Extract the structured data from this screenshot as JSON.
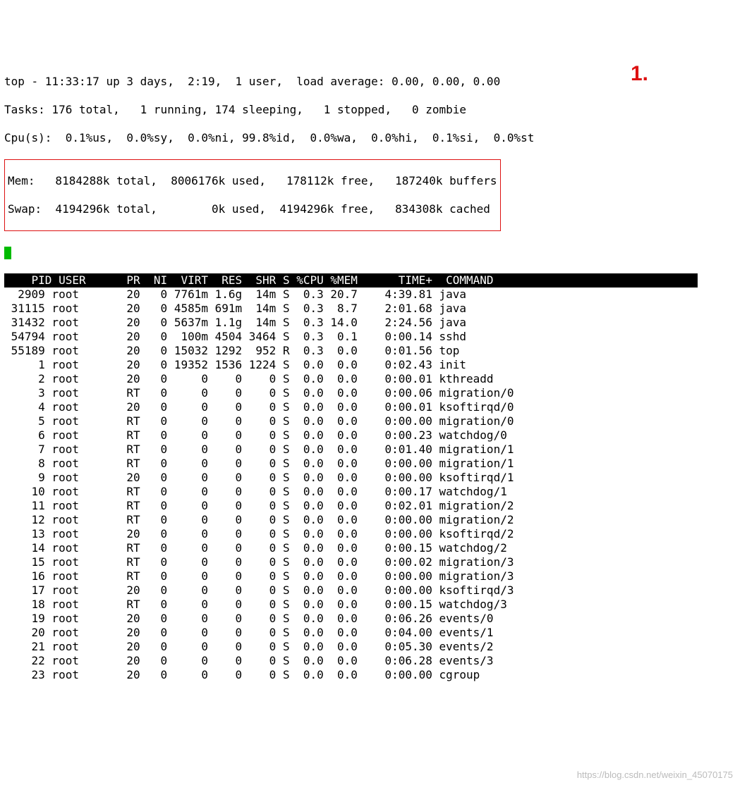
{
  "summary": {
    "line1": "top - 11:33:17 up 3 days,  2:19,  1 user,  load average: 0.00, 0.00, 0.00",
    "line2": "Tasks: 176 total,   1 running, 174 sleeping,   1 stopped,   0 zombie",
    "line3": "Cpu(s):  0.1%us,  0.0%sy,  0.0%ni, 99.8%id,  0.0%wa,  0.0%hi,  0.1%si,  0.0%st",
    "mem": "Mem:   8184288k total,  8006176k used,   178112k free,   187240k buffers",
    "swap": "Swap:  4194296k total,        0k used,  4194296k free,   834308k cached"
  },
  "annotation": "1.",
  "columns": [
    "PID",
    "USER",
    "PR",
    "NI",
    "VIRT",
    "RES",
    "SHR",
    "S",
    "%CPU",
    "%MEM",
    "TIME+",
    "COMMAND"
  ],
  "processes": [
    {
      "pid": "2909",
      "user": "root",
      "pr": "20",
      "ni": "0",
      "virt": "7761m",
      "res": "1.6g",
      "shr": "14m",
      "s": "S",
      "cpu": "0.3",
      "mem": "20.7",
      "time": "4:39.81",
      "cmd": "java"
    },
    {
      "pid": "31115",
      "user": "root",
      "pr": "20",
      "ni": "0",
      "virt": "4585m",
      "res": "691m",
      "shr": "14m",
      "s": "S",
      "cpu": "0.3",
      "mem": "8.7",
      "time": "2:01.68",
      "cmd": "java"
    },
    {
      "pid": "31432",
      "user": "root",
      "pr": "20",
      "ni": "0",
      "virt": "5637m",
      "res": "1.1g",
      "shr": "14m",
      "s": "S",
      "cpu": "0.3",
      "mem": "14.0",
      "time": "2:24.56",
      "cmd": "java"
    },
    {
      "pid": "54794",
      "user": "root",
      "pr": "20",
      "ni": "0",
      "virt": "100m",
      "res": "4504",
      "shr": "3464",
      "s": "S",
      "cpu": "0.3",
      "mem": "0.1",
      "time": "0:00.14",
      "cmd": "sshd"
    },
    {
      "pid": "55189",
      "user": "root",
      "pr": "20",
      "ni": "0",
      "virt": "15032",
      "res": "1292",
      "shr": "952",
      "s": "R",
      "cpu": "0.3",
      "mem": "0.0",
      "time": "0:01.56",
      "cmd": "top"
    },
    {
      "pid": "1",
      "user": "root",
      "pr": "20",
      "ni": "0",
      "virt": "19352",
      "res": "1536",
      "shr": "1224",
      "s": "S",
      "cpu": "0.0",
      "mem": "0.0",
      "time": "0:02.43",
      "cmd": "init"
    },
    {
      "pid": "2",
      "user": "root",
      "pr": "20",
      "ni": "0",
      "virt": "0",
      "res": "0",
      "shr": "0",
      "s": "S",
      "cpu": "0.0",
      "mem": "0.0",
      "time": "0:00.01",
      "cmd": "kthreadd"
    },
    {
      "pid": "3",
      "user": "root",
      "pr": "RT",
      "ni": "0",
      "virt": "0",
      "res": "0",
      "shr": "0",
      "s": "S",
      "cpu": "0.0",
      "mem": "0.0",
      "time": "0:00.06",
      "cmd": "migration/0"
    },
    {
      "pid": "4",
      "user": "root",
      "pr": "20",
      "ni": "0",
      "virt": "0",
      "res": "0",
      "shr": "0",
      "s": "S",
      "cpu": "0.0",
      "mem": "0.0",
      "time": "0:00.01",
      "cmd": "ksoftirqd/0"
    },
    {
      "pid": "5",
      "user": "root",
      "pr": "RT",
      "ni": "0",
      "virt": "0",
      "res": "0",
      "shr": "0",
      "s": "S",
      "cpu": "0.0",
      "mem": "0.0",
      "time": "0:00.00",
      "cmd": "migration/0"
    },
    {
      "pid": "6",
      "user": "root",
      "pr": "RT",
      "ni": "0",
      "virt": "0",
      "res": "0",
      "shr": "0",
      "s": "S",
      "cpu": "0.0",
      "mem": "0.0",
      "time": "0:00.23",
      "cmd": "watchdog/0"
    },
    {
      "pid": "7",
      "user": "root",
      "pr": "RT",
      "ni": "0",
      "virt": "0",
      "res": "0",
      "shr": "0",
      "s": "S",
      "cpu": "0.0",
      "mem": "0.0",
      "time": "0:01.40",
      "cmd": "migration/1"
    },
    {
      "pid": "8",
      "user": "root",
      "pr": "RT",
      "ni": "0",
      "virt": "0",
      "res": "0",
      "shr": "0",
      "s": "S",
      "cpu": "0.0",
      "mem": "0.0",
      "time": "0:00.00",
      "cmd": "migration/1"
    },
    {
      "pid": "9",
      "user": "root",
      "pr": "20",
      "ni": "0",
      "virt": "0",
      "res": "0",
      "shr": "0",
      "s": "S",
      "cpu": "0.0",
      "mem": "0.0",
      "time": "0:00.00",
      "cmd": "ksoftirqd/1"
    },
    {
      "pid": "10",
      "user": "root",
      "pr": "RT",
      "ni": "0",
      "virt": "0",
      "res": "0",
      "shr": "0",
      "s": "S",
      "cpu": "0.0",
      "mem": "0.0",
      "time": "0:00.17",
      "cmd": "watchdog/1"
    },
    {
      "pid": "11",
      "user": "root",
      "pr": "RT",
      "ni": "0",
      "virt": "0",
      "res": "0",
      "shr": "0",
      "s": "S",
      "cpu": "0.0",
      "mem": "0.0",
      "time": "0:02.01",
      "cmd": "migration/2"
    },
    {
      "pid": "12",
      "user": "root",
      "pr": "RT",
      "ni": "0",
      "virt": "0",
      "res": "0",
      "shr": "0",
      "s": "S",
      "cpu": "0.0",
      "mem": "0.0",
      "time": "0:00.00",
      "cmd": "migration/2"
    },
    {
      "pid": "13",
      "user": "root",
      "pr": "20",
      "ni": "0",
      "virt": "0",
      "res": "0",
      "shr": "0",
      "s": "S",
      "cpu": "0.0",
      "mem": "0.0",
      "time": "0:00.00",
      "cmd": "ksoftirqd/2"
    },
    {
      "pid": "14",
      "user": "root",
      "pr": "RT",
      "ni": "0",
      "virt": "0",
      "res": "0",
      "shr": "0",
      "s": "S",
      "cpu": "0.0",
      "mem": "0.0",
      "time": "0:00.15",
      "cmd": "watchdog/2"
    },
    {
      "pid": "15",
      "user": "root",
      "pr": "RT",
      "ni": "0",
      "virt": "0",
      "res": "0",
      "shr": "0",
      "s": "S",
      "cpu": "0.0",
      "mem": "0.0",
      "time": "0:00.02",
      "cmd": "migration/3"
    },
    {
      "pid": "16",
      "user": "root",
      "pr": "RT",
      "ni": "0",
      "virt": "0",
      "res": "0",
      "shr": "0",
      "s": "S",
      "cpu": "0.0",
      "mem": "0.0",
      "time": "0:00.00",
      "cmd": "migration/3"
    },
    {
      "pid": "17",
      "user": "root",
      "pr": "20",
      "ni": "0",
      "virt": "0",
      "res": "0",
      "shr": "0",
      "s": "S",
      "cpu": "0.0",
      "mem": "0.0",
      "time": "0:00.00",
      "cmd": "ksoftirqd/3"
    },
    {
      "pid": "18",
      "user": "root",
      "pr": "RT",
      "ni": "0",
      "virt": "0",
      "res": "0",
      "shr": "0",
      "s": "S",
      "cpu": "0.0",
      "mem": "0.0",
      "time": "0:00.15",
      "cmd": "watchdog/3"
    },
    {
      "pid": "19",
      "user": "root",
      "pr": "20",
      "ni": "0",
      "virt": "0",
      "res": "0",
      "shr": "0",
      "s": "S",
      "cpu": "0.0",
      "mem": "0.0",
      "time": "0:06.26",
      "cmd": "events/0"
    },
    {
      "pid": "20",
      "user": "root",
      "pr": "20",
      "ni": "0",
      "virt": "0",
      "res": "0",
      "shr": "0",
      "s": "S",
      "cpu": "0.0",
      "mem": "0.0",
      "time": "0:04.00",
      "cmd": "events/1"
    },
    {
      "pid": "21",
      "user": "root",
      "pr": "20",
      "ni": "0",
      "virt": "0",
      "res": "0",
      "shr": "0",
      "s": "S",
      "cpu": "0.0",
      "mem": "0.0",
      "time": "0:05.30",
      "cmd": "events/2"
    },
    {
      "pid": "22",
      "user": "root",
      "pr": "20",
      "ni": "0",
      "virt": "0",
      "res": "0",
      "shr": "0",
      "s": "S",
      "cpu": "0.0",
      "mem": "0.0",
      "time": "0:06.28",
      "cmd": "events/3"
    },
    {
      "pid": "23",
      "user": "root",
      "pr": "20",
      "ni": "0",
      "virt": "0",
      "res": "0",
      "shr": "0",
      "s": "S",
      "cpu": "0.0",
      "mem": "0.0",
      "time": "0:00.00",
      "cmd": "cgroup"
    }
  ],
  "watermark": "https://blog.csdn.net/weixin_45070175"
}
